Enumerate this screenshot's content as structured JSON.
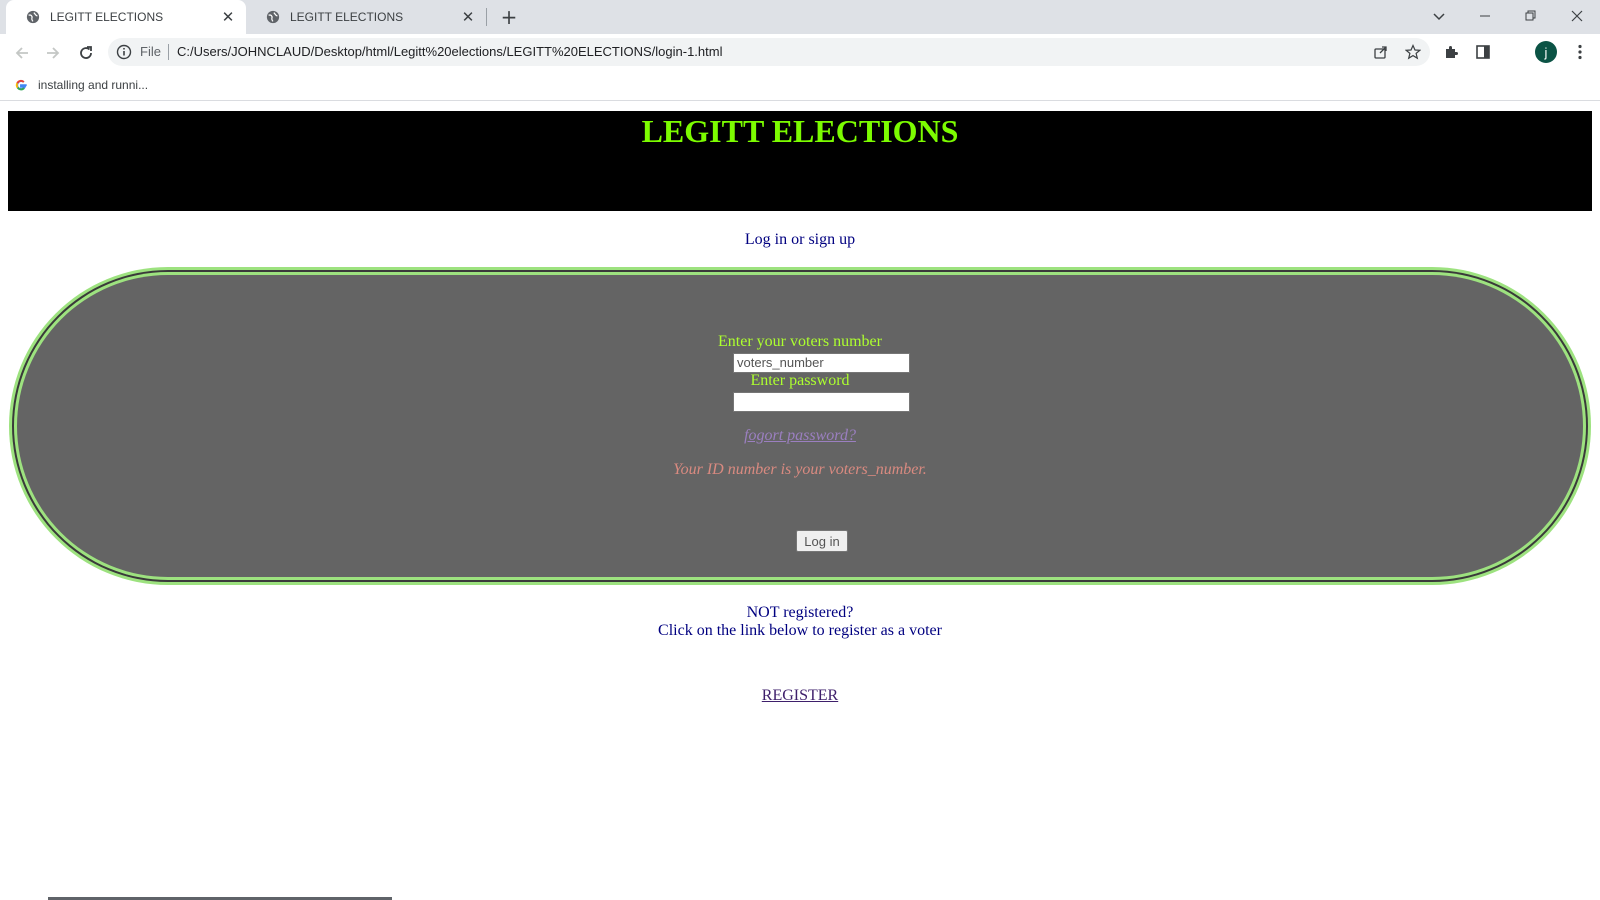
{
  "browser": {
    "tabs": [
      {
        "title": "LEGITT ELECTIONS",
        "active": true
      },
      {
        "title": "LEGITT ELECTIONS",
        "active": false
      }
    ],
    "address": {
      "scheme_label": "File",
      "url": "C:/Users/JOHNCLAUD/Desktop/html/Legitt%20elections/LEGITT%20ELECTIONS/login-1.html"
    },
    "bookmarks": [
      {
        "label": "installing and runni..."
      }
    ],
    "profile_initial": "j"
  },
  "page": {
    "site_title": "LEGITT ELECTIONS",
    "subtitle": "Log in or sign up",
    "form": {
      "voters_number_label": "Enter your voters number",
      "voters_number_value": "voters_number",
      "password_label": "Enter password",
      "password_value": "",
      "forgot_link": "fogort password?",
      "hint": "Your ID number is your voters_number.",
      "login_button": "Log in"
    },
    "not_registered": "NOT registered?",
    "register_instruction": "Click on the link below to register as a voter",
    "register_link": "REGISTER"
  },
  "colors": {
    "title_green": "#7cfc00",
    "label_green": "#adff2f",
    "oval_border": "#9de27f",
    "oval_fill": "#646464",
    "navy_text": "#000080"
  }
}
